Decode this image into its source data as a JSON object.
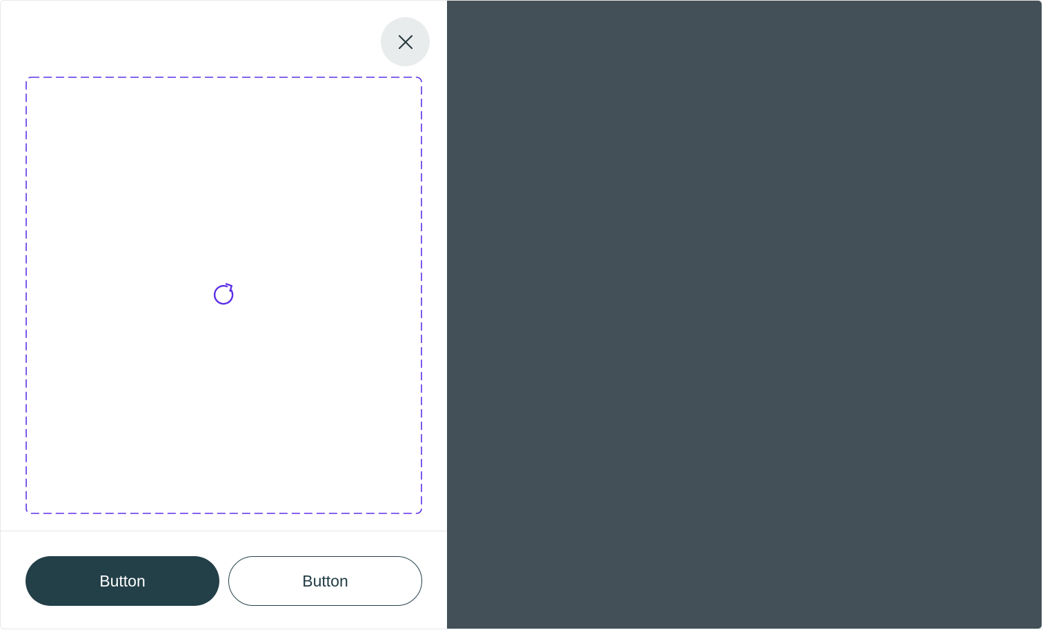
{
  "dialog": {
    "close_icon": "close-icon",
    "drop_zone": {
      "border_color": "#5b2fe6",
      "loading_icon": "refresh-spinner-icon"
    },
    "actions": {
      "primary_label": "Button",
      "secondary_label": "Button"
    }
  },
  "colors": {
    "overlay": "#435057",
    "primary_button": "#233f48",
    "accent": "#5b2fe6",
    "close_button_bg": "#e9ecec"
  }
}
